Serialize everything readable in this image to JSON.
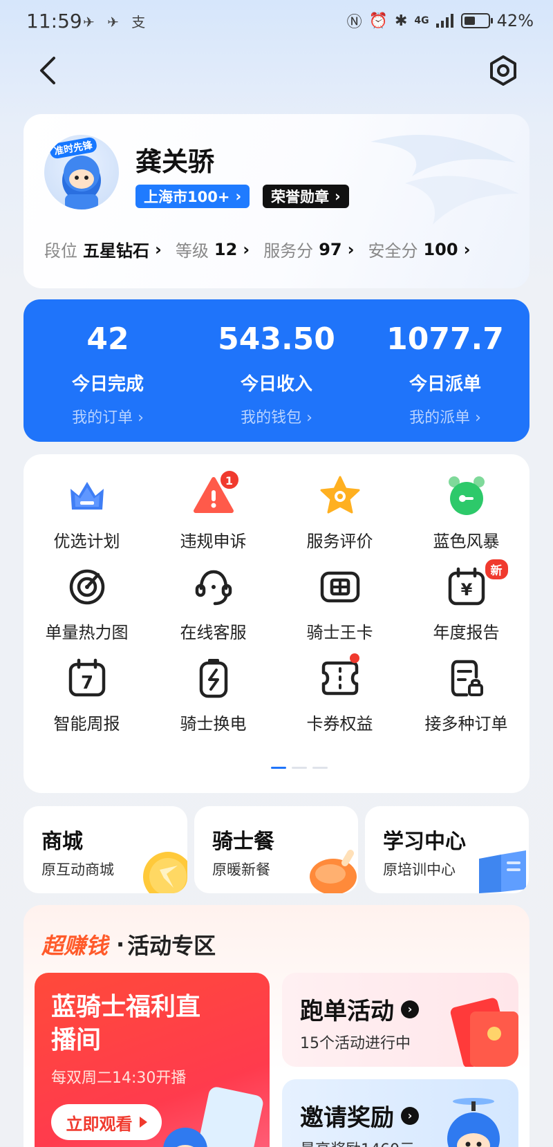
{
  "status_bar": {
    "time": "11:59",
    "notifications": "✈ ✈ 支",
    "signal": "4G",
    "battery": "42%"
  },
  "profile": {
    "name": "龚关骄",
    "avatar_badge": "准时先锋",
    "city_tag": "上海市100+",
    "honor_tag": "荣誉勋章",
    "stats": [
      {
        "label": "段位",
        "value": "五星钻石"
      },
      {
        "label": "等级",
        "value": "12"
      },
      {
        "label": "服务分",
        "value": "97"
      },
      {
        "label": "安全分",
        "value": "100"
      }
    ]
  },
  "summary": [
    {
      "value": "42",
      "title": "今日完成",
      "link": "我的订单 ›"
    },
    {
      "value": "543.50",
      "title": "今日收入",
      "link": "我的钱包 ›"
    },
    {
      "value": "1077.7",
      "title": "今日派单",
      "link": "我的派单 ›"
    }
  ],
  "grid": [
    {
      "label": "优选计划",
      "icon": "crown-icon"
    },
    {
      "label": "违规申诉",
      "icon": "warning-icon",
      "badge": "1"
    },
    {
      "label": "服务评价",
      "icon": "star-icon"
    },
    {
      "label": "蓝色风暴",
      "icon": "alarm-clock-icon"
    },
    {
      "label": "单量热力图",
      "icon": "heatmap-icon"
    },
    {
      "label": "在线客服",
      "icon": "headset-icon"
    },
    {
      "label": "骑士王卡",
      "icon": "sim-card-icon"
    },
    {
      "label": "年度报告",
      "icon": "calendar-yuan-icon",
      "badge": "新"
    },
    {
      "label": "智能周报",
      "icon": "calendar-seven-icon",
      "calendar_day": "7"
    },
    {
      "label": "骑士换电",
      "icon": "battery-swap-icon"
    },
    {
      "label": "卡券权益",
      "icon": "coupon-icon"
    },
    {
      "label": "接多种订单",
      "icon": "order-list-icon"
    }
  ],
  "mini_cards": [
    {
      "title": "商城",
      "sub": "原互动商城"
    },
    {
      "title": "骑士餐",
      "sub": "原暖新餐"
    },
    {
      "title": "学习中心",
      "sub": "原培训中心"
    }
  ],
  "activity": {
    "hot_label": "超赚钱",
    "title": "活动专区",
    "live": {
      "title": "蓝骑士福利直播间",
      "sub": "每双周二14:30开播",
      "button": "立即观看"
    },
    "run": {
      "title": "跑单活动",
      "sub": "15个活动进行中"
    },
    "invite": {
      "title": "邀请奖励",
      "sub": "最高奖励1460元"
    }
  },
  "colors": {
    "primary": "#1f74fa",
    "accent_red": "#f03a2e",
    "hot_orange": "#ff5a2a"
  }
}
